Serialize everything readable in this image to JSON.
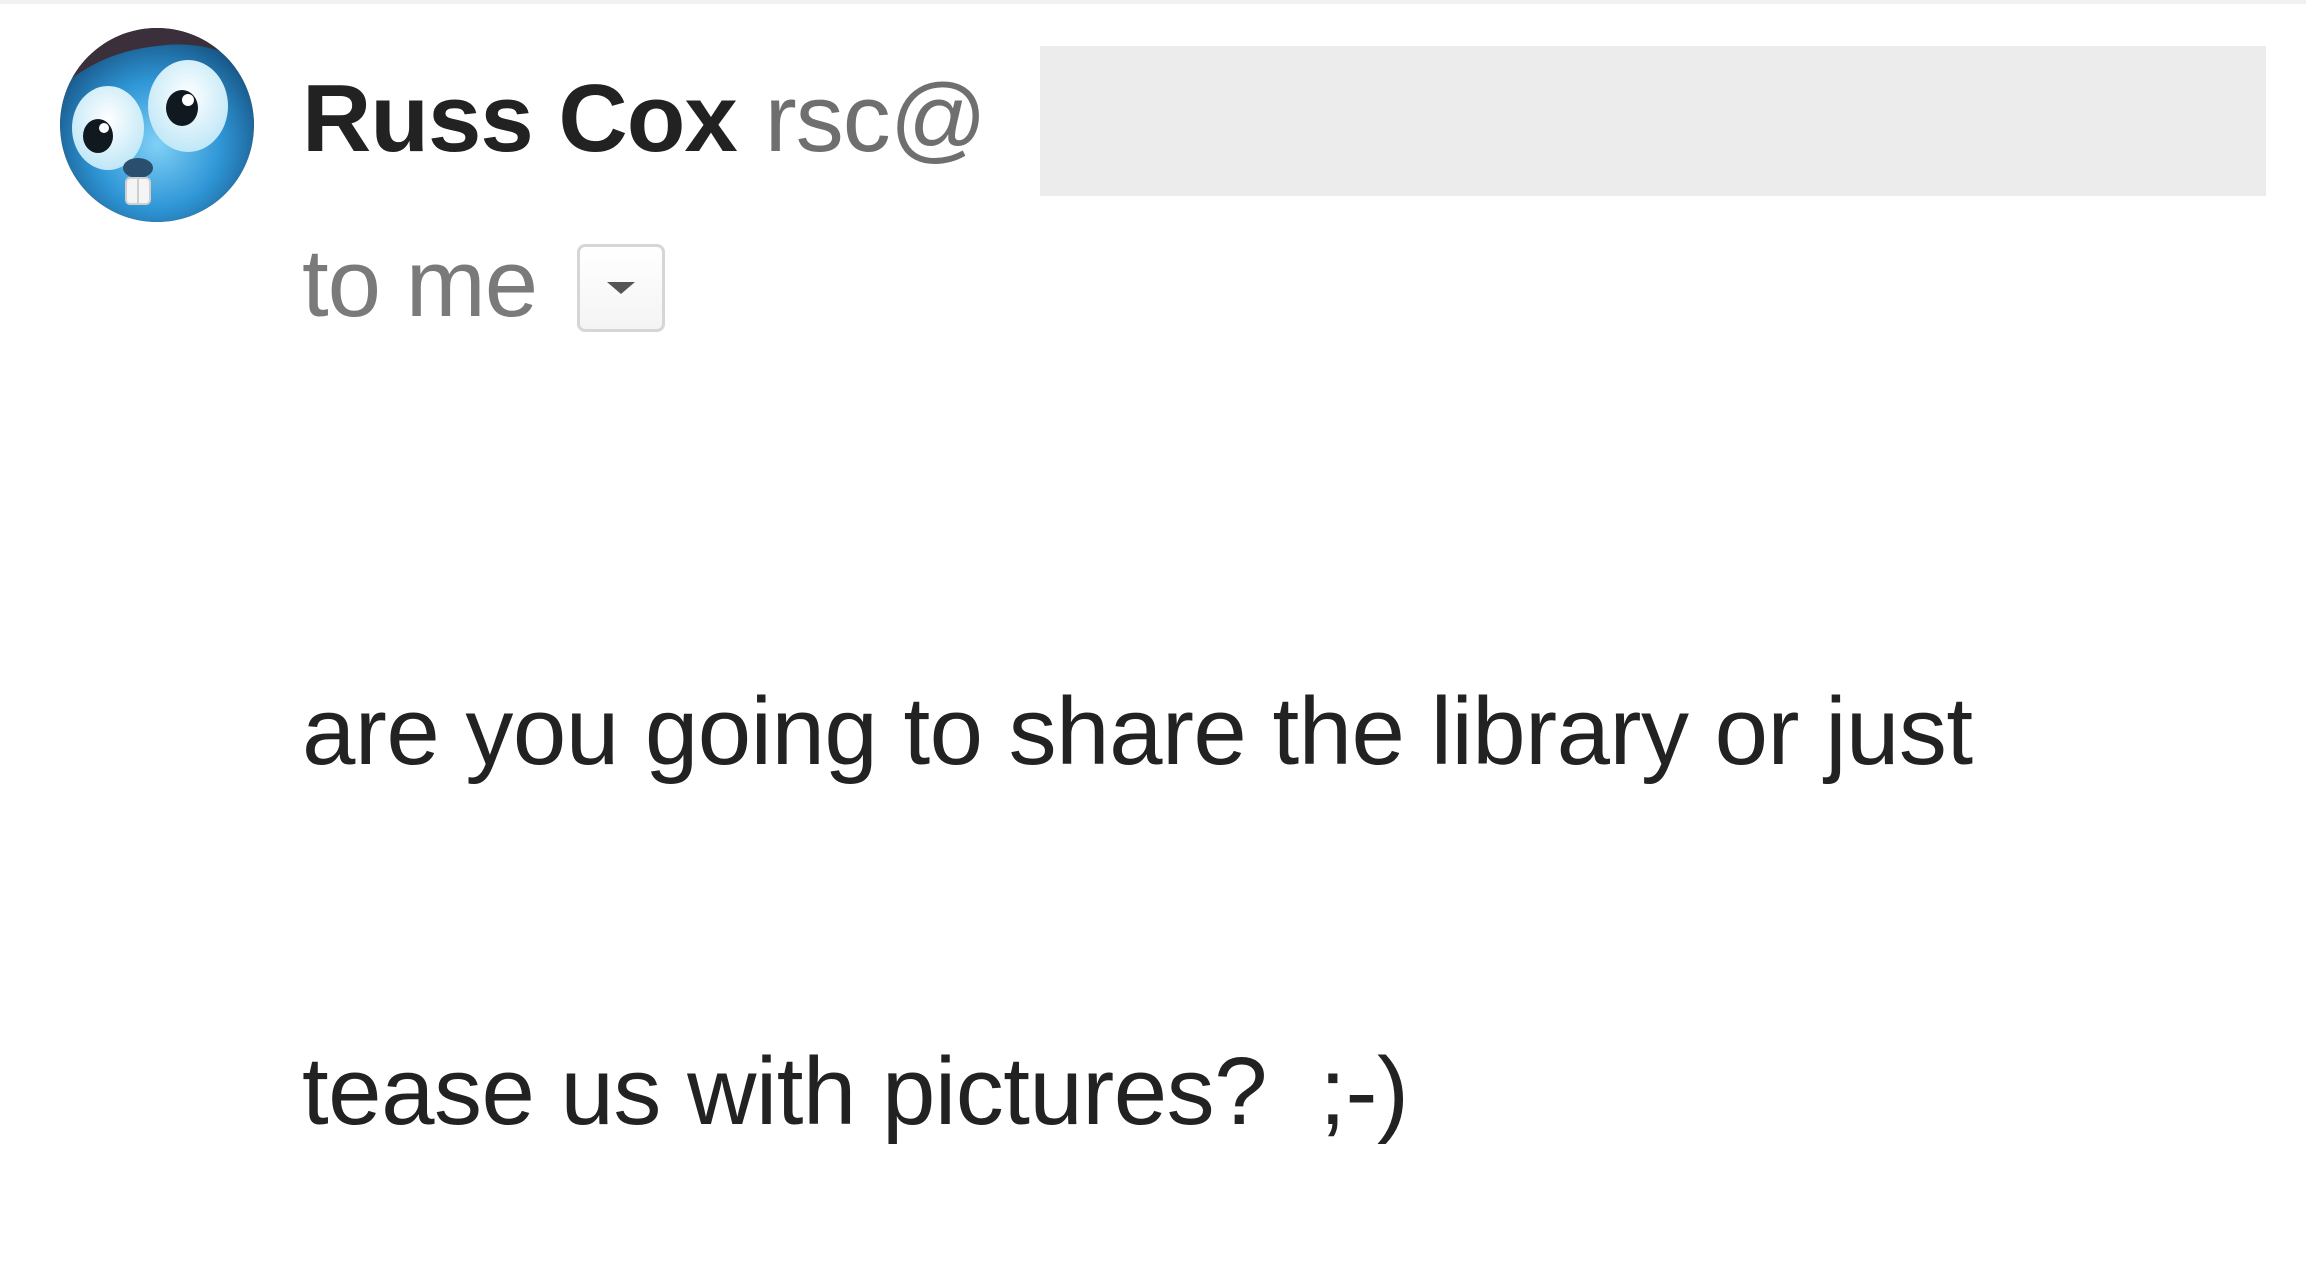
{
  "sender": {
    "name": "Russ Cox",
    "email_visible": "rsc@"
  },
  "recipients": {
    "label": "to me"
  },
  "message": {
    "lines": [
      "are you going to share the library or just",
      "tease us with pictures?  ;-)"
    ]
  },
  "icons": {
    "avatar": "gopher-avatar-icon",
    "details_toggle": "chevron-down-icon"
  },
  "colors": {
    "name_text": "#222222",
    "email_text": "#6f6f6f",
    "to_me_text": "#7a7a7a",
    "redaction_block": "#ececec",
    "avatar_blue": "#2b8fd0"
  }
}
